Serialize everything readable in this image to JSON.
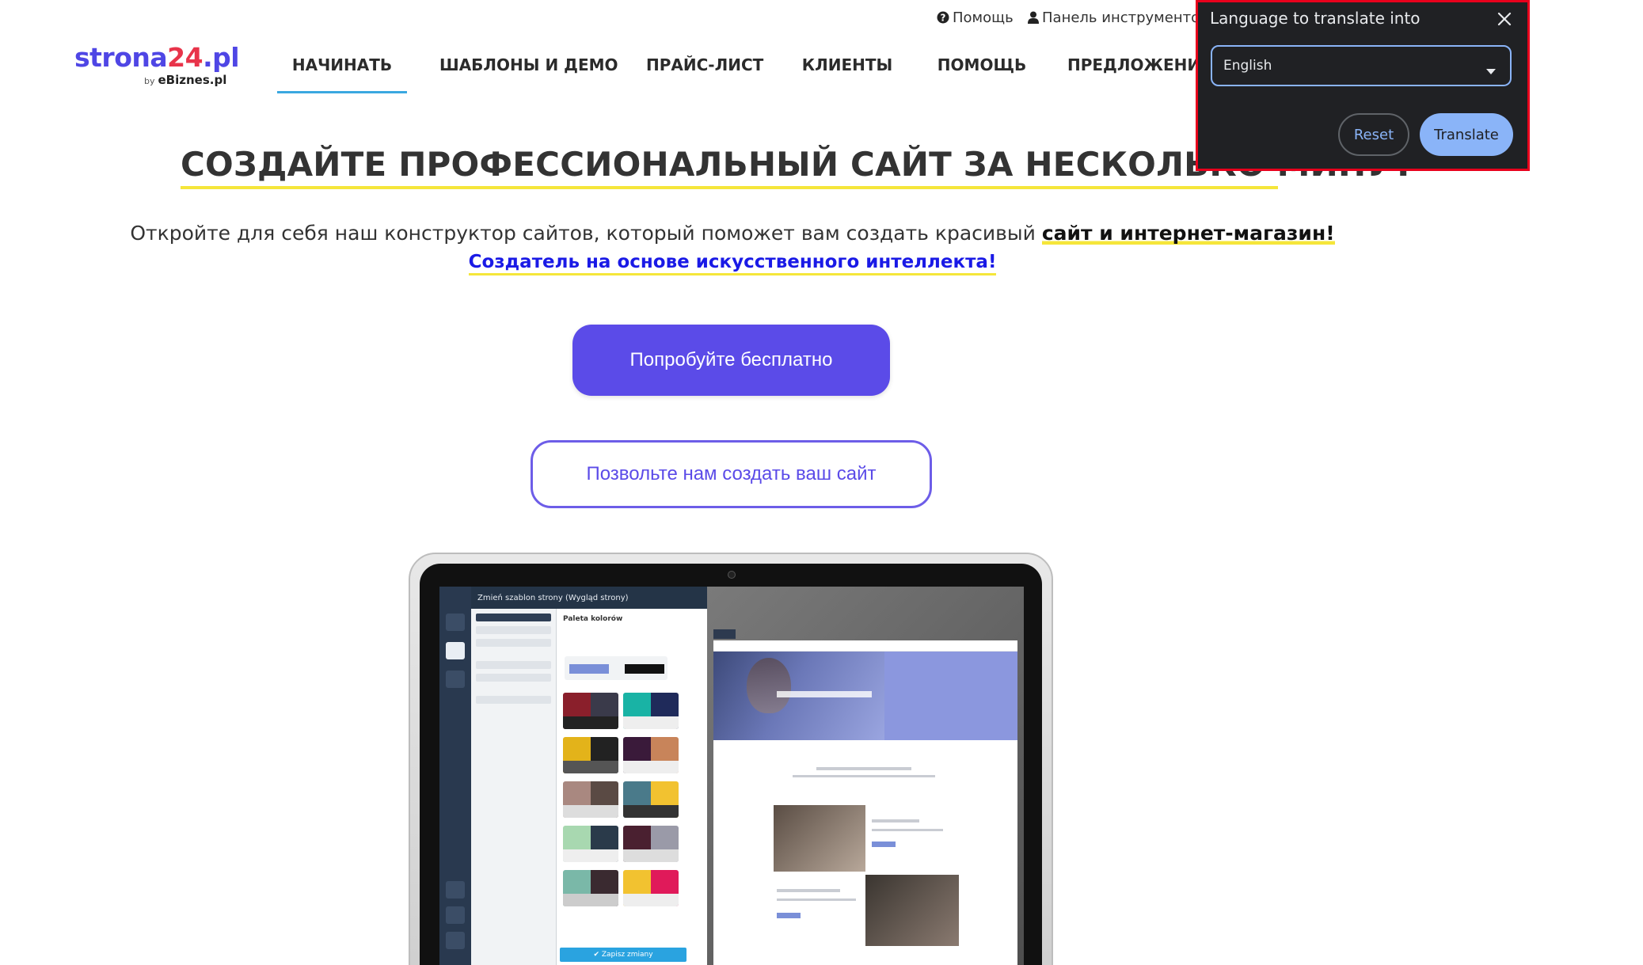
{
  "top_links": {
    "help": "Помощь",
    "panel": "Панель инструментов"
  },
  "logo": {
    "part1": "strona",
    "part2": "24",
    "part3": ".pl",
    "by": "by",
    "brand": "eBiznes.pl"
  },
  "nav": {
    "items": [
      {
        "label": "НАЧИНАТЬ",
        "active": true
      },
      {
        "label": "ШАБЛОНЫ И ДЕМО",
        "active": false
      },
      {
        "label": "ПРАЙС-ЛИСТ",
        "active": false
      },
      {
        "label": "КЛИЕНТЫ",
        "active": false
      },
      {
        "label": "ПОМОЩЬ",
        "active": false
      },
      {
        "label": "ПРЕДЛОЖЕНИЕ",
        "active": false
      }
    ]
  },
  "hero": {
    "title": "СОЗДАЙТЕ ПРОФЕССИОНАЛЬНЫЙ САЙТ ЗА НЕСКОЛЬКО МИНУТ",
    "subtitle_plain": "Откройте для себя наш конструктор сайтов, который поможет вам создать красивый ",
    "subtitle_strong": "сайт и интернет-магазин!",
    "ai_line": "Создатель на основе искусственного интеллекта!",
    "primary_button": "Попробуйте бесплатно",
    "secondary_button": "Позвольте нам создать ваш сайт"
  },
  "mockup": {
    "editor_title": "Zmień szablon strony (Wygląd strony)",
    "palette_title": "Paleta kolorów",
    "save_button": "✔ Zapisz zmiany"
  },
  "translate_popup": {
    "title": "Language to translate into",
    "selected_language": "English",
    "reset_label": "Reset",
    "translate_label": "Translate",
    "close_icon": "close-icon"
  },
  "colors": {
    "accent": "#5b4be8",
    "highlight": "#f5e63a",
    "ai_link": "#1a1ae6",
    "nav_underline": "#3aa8e0",
    "popup_bg": "#202124",
    "popup_border": "#e8001c",
    "translate_button": "#8ab4f8"
  }
}
